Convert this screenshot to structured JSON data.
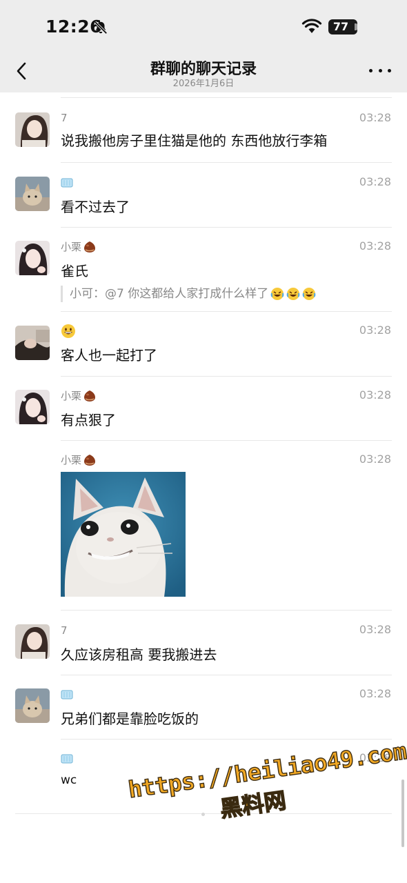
{
  "status_bar": {
    "time": "12:26",
    "battery": "77",
    "icons": [
      "bell-slash-icon",
      "wifi-icon",
      "battery-icon"
    ]
  },
  "nav": {
    "title": "群聊的聊天记录",
    "subtitle": "2026年1月6日",
    "icons": [
      "chevron-left-icon",
      "more-icon"
    ]
  },
  "messages": [
    {
      "sender": "7",
      "sender_badge": "",
      "time": "03:28",
      "text": "说我搬他房子里住猫是他的 东西他放行李箱",
      "avatar": "girl-portrait"
    },
    {
      "sender": "",
      "sender_badge": "ice-cube-emoji",
      "time": "03:28",
      "text": "看不过去了",
      "avatar": "cat-photo"
    },
    {
      "sender": "小栗",
      "sender_badge": "chestnut-emoji",
      "time": "03:28",
      "text": "雀氏",
      "quote": "小可：@7 你这都给人家打成什么样了",
      "quote_emojis": [
        "laugh-cry-emoji",
        "laugh-cry-emoji",
        "laugh-cry-emoji"
      ],
      "avatar": "girl-selfie"
    },
    {
      "sender": "",
      "sender_badge": "smiley-emoji",
      "time": "03:28",
      "text": "客人也一起打了",
      "avatar": "dark-photo"
    },
    {
      "sender": "小栗",
      "sender_badge": "chestnut-emoji",
      "time": "03:28",
      "text": "有点狠了",
      "avatar": "girl-selfie"
    },
    {
      "sender": "小栗",
      "sender_badge": "chestnut-emoji",
      "time": "03:28",
      "text": "",
      "sticker": "cat-meme-sticker"
    },
    {
      "sender": "7",
      "sender_badge": "",
      "time": "03:28",
      "text": "久应该房租高 要我搬进去",
      "avatar": "girl-portrait"
    },
    {
      "sender": "",
      "sender_badge": "ice-cube-emoji",
      "time": "03:28",
      "text": "兄弟们都是靠脸吃饭的",
      "avatar": "cat-photo"
    },
    {
      "sender": "",
      "sender_badge": "ice-cube-emoji",
      "time": "03:28",
      "text": "wc"
    }
  ],
  "watermark": {
    "line1": "https://heiliao49.com",
    "line2": "黑料网"
  },
  "colors": {
    "header_bg": "#ededed",
    "divider": "#e7e7e7",
    "watermark": "#f1a824"
  }
}
